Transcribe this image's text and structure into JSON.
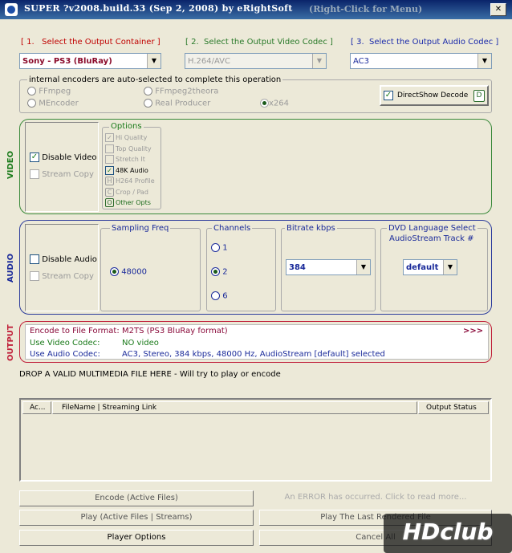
{
  "window": {
    "title": "SUPER ?v2008.build.33 (Sep 2, 2008) by eRightSoft",
    "hint": "(Right-Click for Menu)"
  },
  "steps": {
    "container": {
      "num": "[ 1.",
      "label": "Select the Output Container ]",
      "value": "Sony - PS3  (BluRay)"
    },
    "video_codec": {
      "num": "[ 2.",
      "label": "Select the Output Video Codec ]",
      "value": "H.264/AVC"
    },
    "audio_codec": {
      "num": "[ 3.",
      "label": "Select the Output Audio Codec ]",
      "value": "AC3"
    }
  },
  "encoders": {
    "label": "internal encoders are auto-selected to complete this operation",
    "options": [
      "FFmpeg",
      "MEncoder",
      "FFmpeg2theora",
      "Real Producer",
      "x264"
    ],
    "directshow": {
      "label": "DirectShow Decode",
      "key": "D"
    }
  },
  "video": {
    "section_label": "VIDEO",
    "disable_video": "Disable Video",
    "stream_copy": "Stream Copy",
    "options_title": "Options",
    "options": [
      {
        "label": "Hi Quality",
        "key": "",
        "checked": true,
        "enabled": false
      },
      {
        "label": "Top Quality",
        "key": "",
        "checked": false,
        "enabled": false
      },
      {
        "label": "Stretch It",
        "key": "",
        "checked": false,
        "enabled": false
      },
      {
        "label": "48K Audio",
        "key": "",
        "checked": true,
        "enabled": true
      },
      {
        "label": "H264 Profile",
        "key": "H",
        "checked": false,
        "enabled": false
      },
      {
        "label": "Crop / Pad",
        "key": "C",
        "checked": false,
        "enabled": false
      },
      {
        "label": "Other Opts",
        "key": "O",
        "checked": false,
        "enabled": true
      }
    ]
  },
  "audio": {
    "section_label": "AUDIO",
    "disable_audio": "Disable Audio",
    "stream_copy": "Stream Copy",
    "sampling_title": "Sampling Freq",
    "sampling_value": "48000",
    "channels_title": "Channels",
    "channels": [
      "1",
      "2",
      "6"
    ],
    "bitrate_title": "Bitrate  kbps",
    "bitrate_value": "384",
    "dvd_title": "DVD Language Select",
    "dvd_subtitle": "AudioStream  Track #",
    "dvd_value": "default"
  },
  "output": {
    "section_label": "OUTPUT",
    "rows": [
      {
        "label": "Encode to File Format:",
        "value": "M2TS (PS3 BluRay format)"
      },
      {
        "label": "Use Video Codec:",
        "value": "NO video"
      },
      {
        "label": "Use Audio Codec:",
        "value": "AC3,  Stereo,  384 kbps,  48000 Hz,  AudioStream [default] selected"
      }
    ],
    "more": ">>>"
  },
  "drop_hint": "DROP A VALID MULTIMEDIA FILE HERE - Will try to play or encode",
  "file_table": {
    "columns": [
      "Ac...",
      "FileName  |  Streaming Link",
      "Output Status"
    ]
  },
  "buttons": {
    "encode": "Encode (Active Files)",
    "error": "An ERROR has occurred. Click to read more...",
    "play": "Play (Active Files | Streams)",
    "play_last": "Play The Last Rendered File",
    "player_options": "Player Options",
    "cancel": "Cancel All"
  },
  "watermark": "HDclub"
}
